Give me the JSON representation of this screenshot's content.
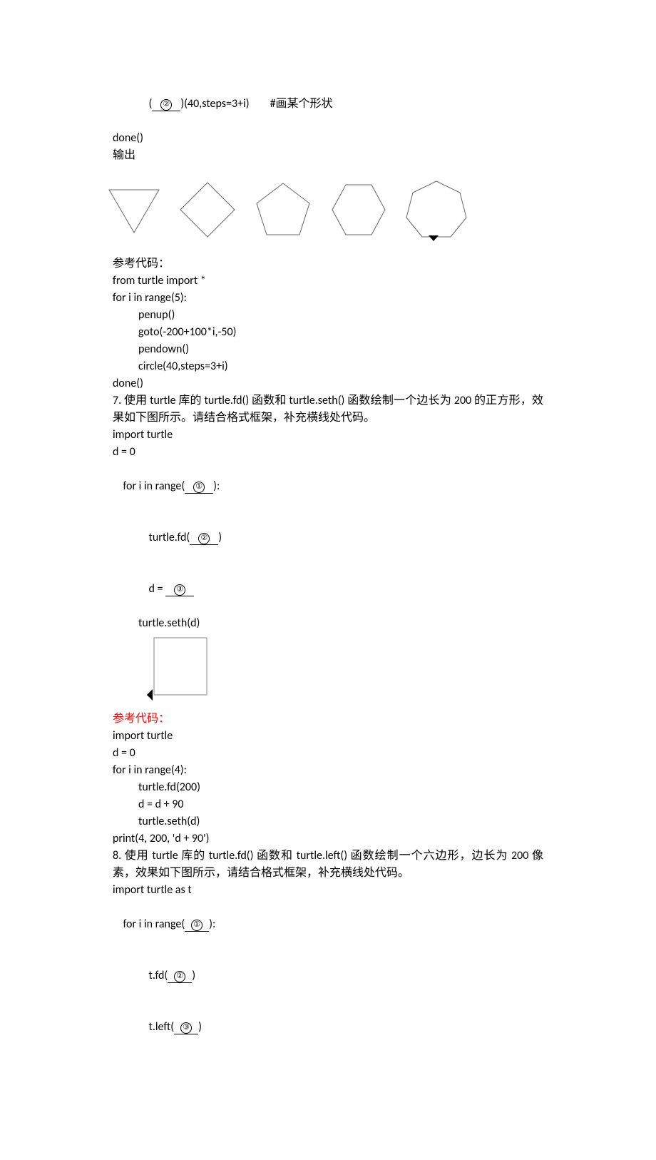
{
  "q6_tail": {
    "line1_a": "(",
    "blank2": "②",
    "line1_b": ")(40,steps=3+i)        #画某个形状",
    "done": "done()",
    "output_label": "输出"
  },
  "q6_ref": {
    "heading": "参考代码：",
    "l1": "from turtle import *",
    "l2": "for i in range(5):",
    "l3": "penup()",
    "l4": "goto(-200+100*i,-50)",
    "l5": "pendown()",
    "l6": "circle(40,steps=3+i)",
    "l7": "done()"
  },
  "q7": {
    "prompt": "7. 使用 turtle 库的 turtle.fd() 函数和 turtle.seth() 函数绘制一个边长为 200 的正方形，效果如下图所示。请结合格式框架，补充横线处代码。",
    "l1": "import turtle",
    "l2": "d = 0",
    "l3a": "for i in range(",
    "c1": "①",
    "l3b": "):",
    "l4a": "turtle.fd(",
    "c2": "②",
    "l4b": ")",
    "l5a": "d = ",
    "c3": "③",
    "l6": "turtle.seth(d)"
  },
  "q7_ref": {
    "heading": "参考代码：",
    "l1": "import turtle",
    "l2": "d = 0",
    "l3": "for i in range(4):",
    "l4": "turtle.fd(200)",
    "l5": "d = d + 90",
    "l6": "turtle.seth(d)",
    "l7": "print(4, 200, 'd + 90')"
  },
  "q8": {
    "prompt": "8. 使用 turtle 库的 turtle.fd() 函数和 turtle.left() 函数绘制一个六边形，边长为 200 像素，效果如下图所示，请结合格式框架，补充横线处代码。",
    "l1": "import turtle as t",
    "l2a": "for i in range(",
    "c1": "①",
    "l2b": "):",
    "l3a": "t.fd(",
    "c2": "②",
    "l3b": ")",
    "l4a": "t.left(",
    "c3": "③",
    "l4b": ")"
  }
}
